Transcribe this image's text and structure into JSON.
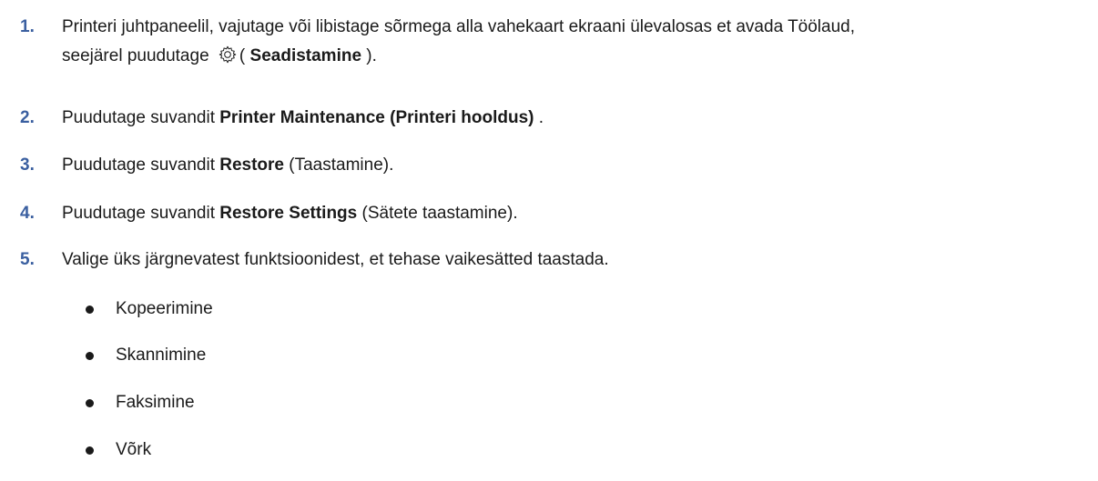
{
  "steps": [
    {
      "number": "1.",
      "line1": "Printeri juhtpaneelil, vajutage või libistage sõrmega alla vahekaart ekraani ülevalosas et avada Töölaud,",
      "line2_pre": "seejärel puudutage ",
      "icon": "gear-icon",
      "line2_paren_open": "( ",
      "line2_bold": "Seadistamine",
      "line2_post": " )."
    },
    {
      "number": "2.",
      "pre": "Puudutage suvandit ",
      "bold": "Printer Maintenance (Printeri hooldus)",
      "post": " ."
    },
    {
      "number": "3.",
      "pre": "Puudutage suvandit ",
      "bold": "Restore",
      "post": " (Taastamine)."
    },
    {
      "number": "4.",
      "pre": "Puudutage suvandit ",
      "bold": "Restore Settings",
      "post": " (Sätete taastamine)."
    },
    {
      "number": "5.",
      "text": "Valige üks järgnevatest funktsioonidest, et tehase vaikesätted taastada."
    }
  ],
  "options": [
    "Kopeerimine",
    "Skannimine",
    "Faksimine",
    "Võrk"
  ],
  "colors": {
    "step_number": "#3a5fa0",
    "text": "#1a1a1a"
  }
}
